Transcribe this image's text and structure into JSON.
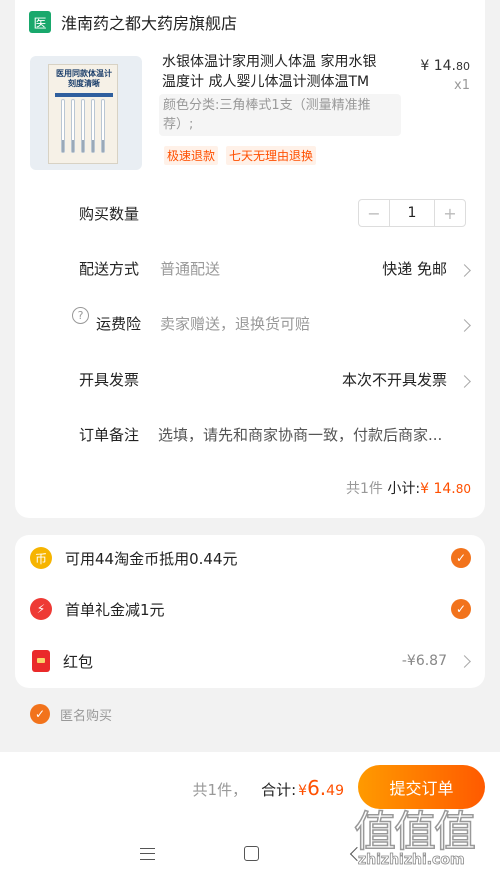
{
  "shop": {
    "badge": "医",
    "name": "淮南药之都大药房旗舰店"
  },
  "product": {
    "image_title": "医用同款体温计刻度清晰",
    "title": "水银体温计家用测人体温 家用水银温度计 成人婴儿体温计测体温TM",
    "price_currency": "¥",
    "price_int": "14.",
    "price_dec": "80",
    "quantity": "x1",
    "spec": "颜色分类:三角棒式1支（测量精准推荐）;",
    "tags": [
      "极速退款",
      "七天无理由退换"
    ]
  },
  "rows": {
    "quantity_label": "购买数量",
    "quantity_value": "1",
    "minus": "−",
    "plus": "+",
    "delivery_label": "配送方式",
    "delivery_sub": "普通配送",
    "delivery_value": "快递 免邮",
    "insurance_icon": "?",
    "insurance_label": "运费险",
    "insurance_sub": "卖家赠送，退换货可赔",
    "invoice_label": "开具发票",
    "invoice_value": "本次不开具发票",
    "note_label": "订单备注",
    "note_placeholder": "选填，请先和商家协商一致，付款后商家..."
  },
  "subtotal": {
    "count": "共1件",
    "label": "小计:",
    "currency": "¥ ",
    "int": "14.",
    "dec": "80"
  },
  "promos": [
    {
      "icon": "coin-icon",
      "glyph": "币",
      "text": "可用44淘金币抵用0.44元",
      "checked": true
    },
    {
      "icon": "lightning-icon",
      "glyph": "⚡",
      "text": "首单礼金减1元",
      "checked": true
    },
    {
      "icon": "red-packet-icon",
      "text": "红包",
      "value": "-¥6.87"
    }
  ],
  "anonymous": {
    "label": "匿名购买",
    "checked": true
  },
  "bottom": {
    "count": "共1件，",
    "total_label": "合计:",
    "currency": "¥ ",
    "total_int": "6.",
    "total_dec": "49",
    "submit": "提交订单"
  },
  "watermark": {
    "glyphs": "值值值",
    "url": "zhizhizhi.com"
  },
  "colors": {
    "accent": "#ff5000",
    "brand_green": "#19a86c",
    "check": "#f2731c"
  }
}
